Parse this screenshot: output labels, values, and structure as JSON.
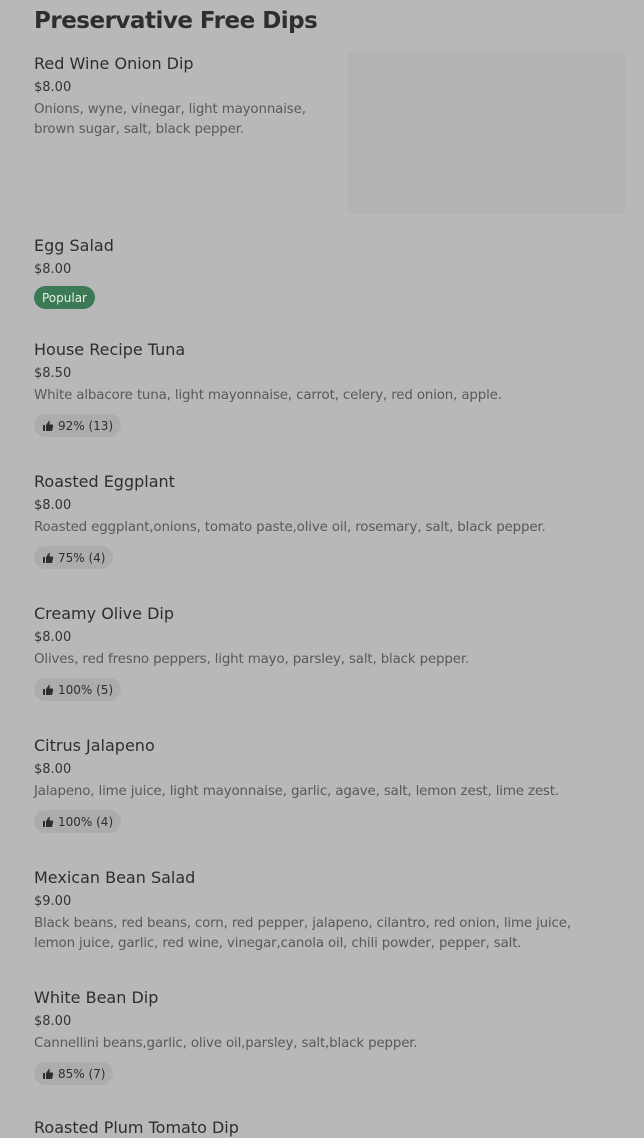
{
  "section": {
    "title": "Preservative Free Dips"
  },
  "items": [
    {
      "name": "Red Wine Onion Dip",
      "price": "$8.00",
      "description": "Onions, wyne, vinegar, light mayonnaise, brown sugar, salt, black pepper."
    },
    {
      "name": "Egg Salad",
      "price": "$8.00",
      "badge": "Popular"
    },
    {
      "name": "House Recipe Tuna",
      "price": "$8.50",
      "description": "White albacore tuna, light mayonnaise, carrot, celery, red onion, apple.",
      "rating": "92% (13)"
    },
    {
      "name": "Roasted Eggplant",
      "price": "$8.00",
      "description": "Roasted eggplant,onions, tomato paste,olive oil, rosemary, salt, black pepper.",
      "rating": "75% (4)"
    },
    {
      "name": "Creamy Olive Dip",
      "price": "$8.00",
      "description": "Olives, red fresno peppers, light mayo, parsley, salt, black pepper.",
      "rating": "100% (5)"
    },
    {
      "name": "Citrus Jalapeno",
      "price": "$8.00",
      "description": "Jalapeno, lime juice, light mayonnaise, garlic, agave, salt, lemon zest, lime zest.",
      "rating": "100% (4)"
    },
    {
      "name": "Mexican Bean Salad",
      "price": "$9.00",
      "description": "Black beans, red beans, corn, red pepper, jalapeno, cilantro, red onion, lime juice, lemon juice, garlic, red wine, vinegar,canola oil, chili powder, pepper, salt."
    },
    {
      "name": "White Bean Dip",
      "price": "$8.00",
      "description": "Cannellini beans,garlic, olive oil,parsley, salt,black pepper.",
      "rating": "85% (7)"
    },
    {
      "name": "Roasted Plum Tomato Dip"
    }
  ],
  "icons": {
    "rating": "thumbs-up-icon"
  }
}
